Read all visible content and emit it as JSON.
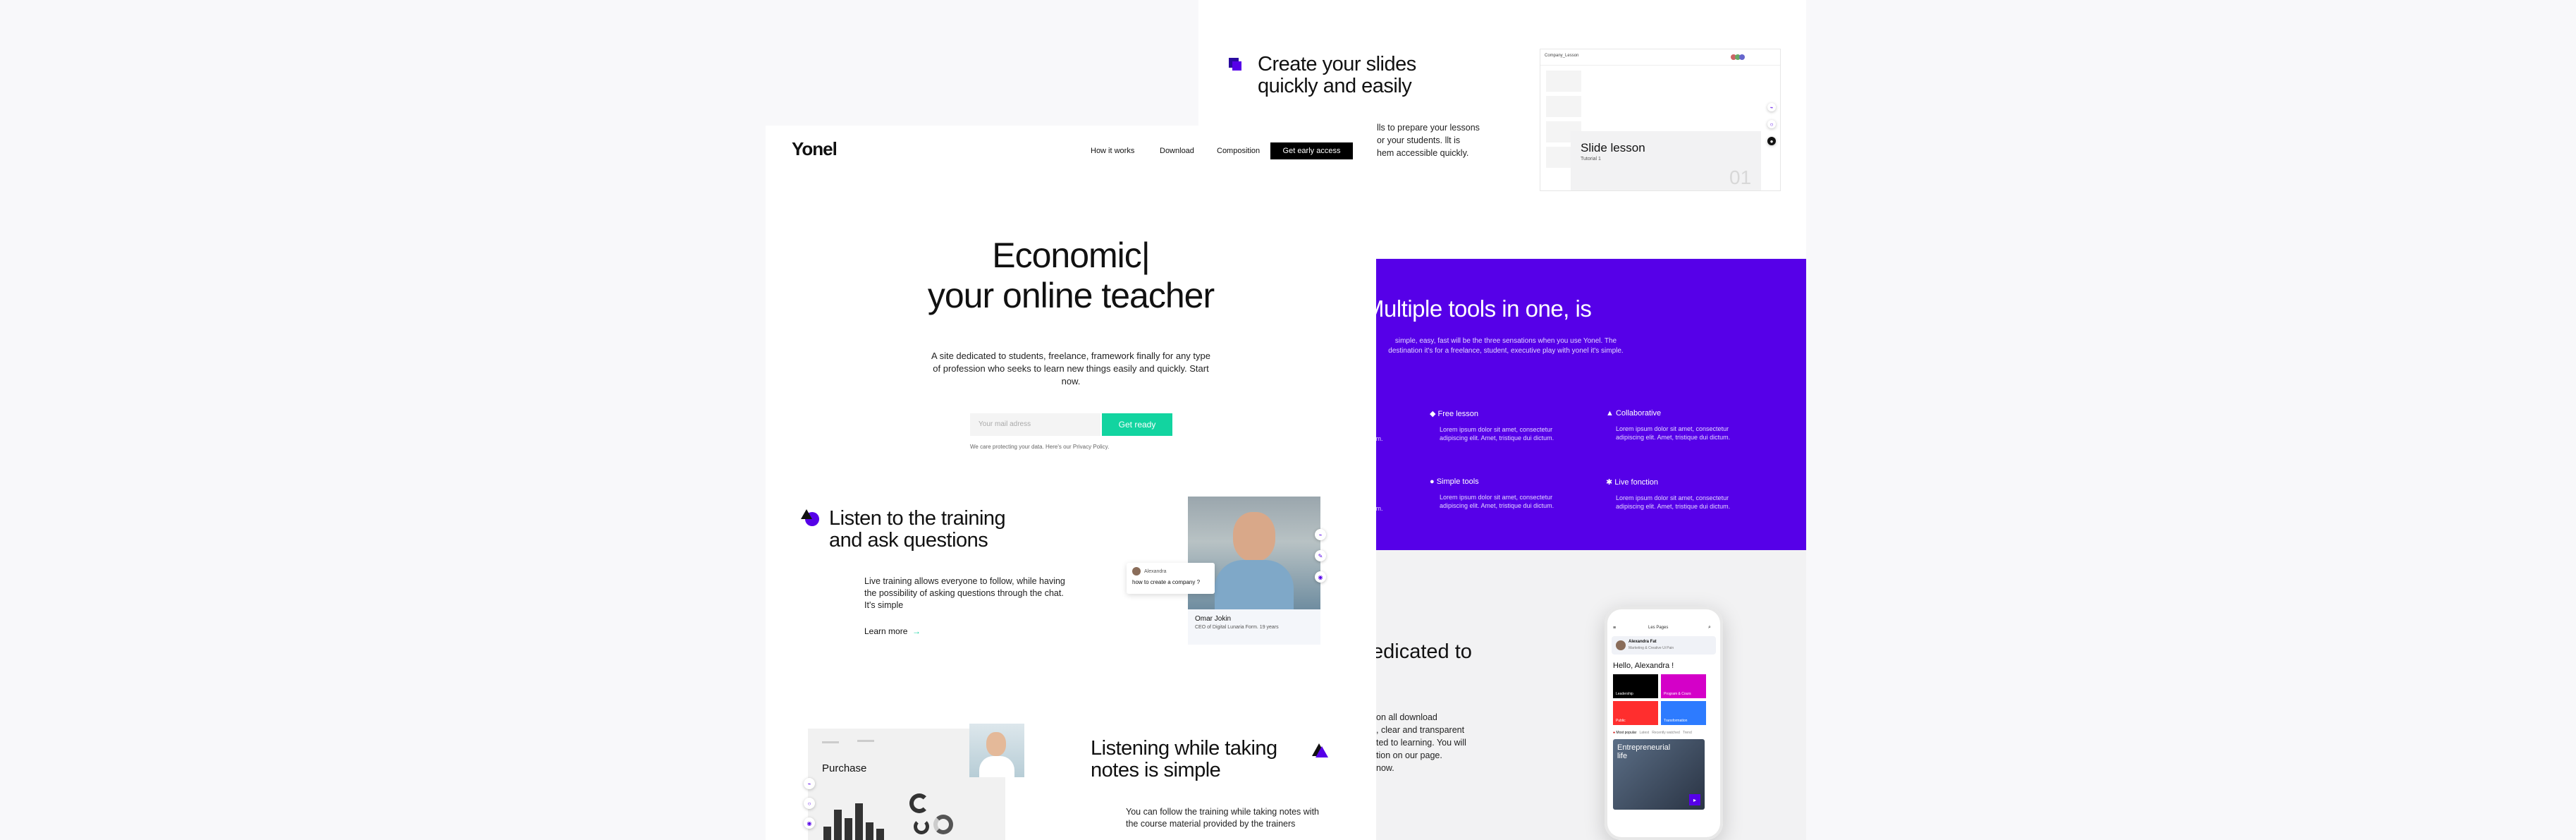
{
  "nav": {
    "logo": "Yonel",
    "links": [
      "How it works",
      "Download",
      "Composition"
    ],
    "cta": "Get early access"
  },
  "hero": {
    "line1": "Economic|",
    "line2": "your online teacher",
    "description": "A site dedicated to students, freelance, framework finally for any type of profession who seeks to learn new things easily and quickly. Start now.",
    "email_placeholder": "Your mail adress",
    "button": "Get ready",
    "privacy": "We care protecting your data. Here's our Privacy Policy."
  },
  "listen": {
    "title_line1": "Listen to the training",
    "title_line2": "and ask questions",
    "description": "Live training allows everyone to follow, while having the possibility of asking questions through the chat. It's simple",
    "learn_more": "Learn more",
    "chat_name": "Alexandra",
    "chat_message": "how to create a company ?",
    "person_name": "Omar Jokin",
    "person_title": "CEO of Digital Lunaria Form. 19 years"
  },
  "notes": {
    "title_line1": "Listening while taking",
    "title_line2": "notes is simple",
    "description": "You can follow the training while taking notes with the course material provided by the trainers",
    "card_title": "Purchase",
    "bars": [
      0.35,
      0.75,
      0.55,
      0.9,
      0.45,
      0.3
    ]
  },
  "slides": {
    "title_line1": "Create your slides",
    "title_line2": "quickly and easily",
    "description_lines": [
      "lls to prepare your lessons",
      "or your students. llt is",
      "hem accessible quickly."
    ],
    "mock_title": "Slide lesson",
    "mock_sub": "Tutorial 1",
    "mock_number": "01",
    "mock_header": "Company_Lesson"
  },
  "tools": {
    "title": "Multiple tools in one, is",
    "description": "simple, easy, fast will be the three sensations when you use Yonel. The destination it's for a freelance, student, executive play with yonel it's simple.",
    "features": [
      {
        "name": "Free lesson",
        "desc": "Lorem ipsum dolor sit amet, consectetur adipiscing elit. Amet, tristique dui dictum."
      },
      {
        "name": "Collaborative",
        "desc": "Lorem ipsum dolor sit amet, consectetur adipiscing elit. Amet, tristique dui dictum."
      },
      {
        "name": "Simple tools",
        "desc": "Lorem ipsum dolor sit amet, consectetur adipiscing elit. Amet, tristique dui dictum."
      },
      {
        "name": "Live fonction",
        "desc": "Lorem ipsum dolor sit amet, consectetur adipiscing elit. Amet, tristique dui dictum."
      }
    ],
    "left_fragments": [
      "tum.",
      "tum."
    ]
  },
  "dedicated": {
    "title": "edicated to",
    "lines": [
      "on all download",
      ", clear and transparent",
      "ted to learning. You will",
      "tion on our page.",
      "now."
    ]
  },
  "phone": {
    "header": "Les Pages",
    "user_name": "Alexandra Fat",
    "user_sub": "Marketing & Creative Ui Pain",
    "greeting": "Hello, Alexandra !",
    "tiles": [
      "Leadership",
      "Program & Cours",
      "Public",
      "Transformation"
    ],
    "tile_colors": [
      "#000000",
      "#d400c8",
      "#ff2e2e",
      "#2d7bff"
    ],
    "tabs": [
      "Most popular",
      "Latest",
      "Recently watched",
      "Trend"
    ],
    "promo": "Entrepreneurial life"
  },
  "colors": {
    "accent": "#5600e8",
    "green": "#12d4a0"
  }
}
